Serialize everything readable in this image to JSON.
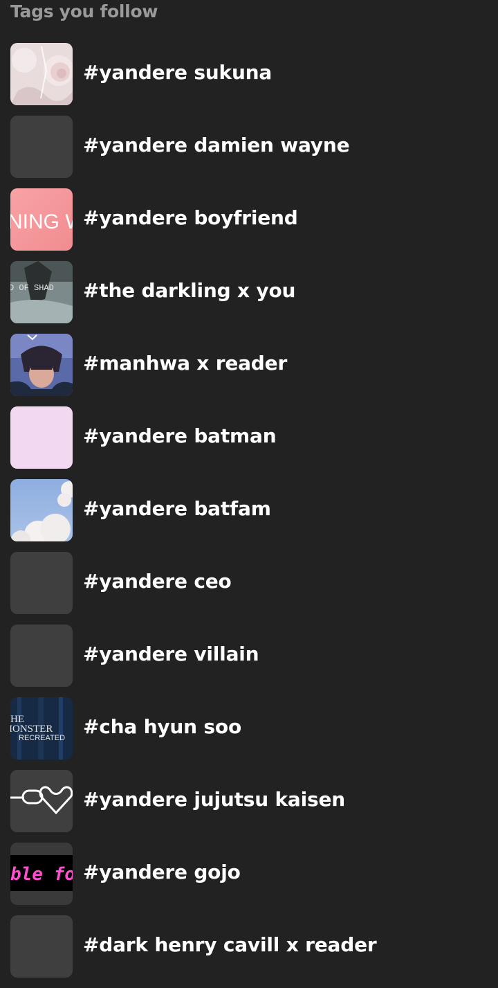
{
  "header": {
    "title": "Tags you follow"
  },
  "tags": [
    {
      "label": "#yandere sukuna",
      "thumb": "pink-rose-photo"
    },
    {
      "label": "#yandere damien wayne",
      "thumb": "blank"
    },
    {
      "label": "#yandere boyfriend",
      "thumb": "pink-text-banner",
      "thumb_text": "NING W"
    },
    {
      "label": "#the darkling x you",
      "thumb": "dark-figure-photo",
      "thumb_text": "D OF SHAD"
    },
    {
      "label": "#manhwa x reader",
      "thumb": "manhwa-character-art"
    },
    {
      "label": "#yandere batman",
      "thumb": "pale-pink"
    },
    {
      "label": "#yandere batfam",
      "thumb": "sky-clouds-photo"
    },
    {
      "label": "#yandere ceo",
      "thumb": "blank"
    },
    {
      "label": "#yandere villain",
      "thumb": "blank"
    },
    {
      "label": "#cha hyun soo",
      "thumb": "monster-recreated-cover",
      "thumb_text_1": "HE",
      "thumb_text_2": "IONSTER",
      "thumb_text_3": "RECREATED"
    },
    {
      "label": "#yandere jujutsu kaisen",
      "thumb": "chain-heart-icon"
    },
    {
      "label": "#yandere gojo",
      "thumb": "neon-text",
      "thumb_text": "ble fo"
    },
    {
      "label": "#dark henry cavill x reader",
      "thumb": "blank"
    }
  ],
  "colors": {
    "background": "#222222",
    "header_text": "#9a9a9a",
    "tag_text": "#ffffff",
    "placeholder_thumb": "#3f3f3f"
  }
}
